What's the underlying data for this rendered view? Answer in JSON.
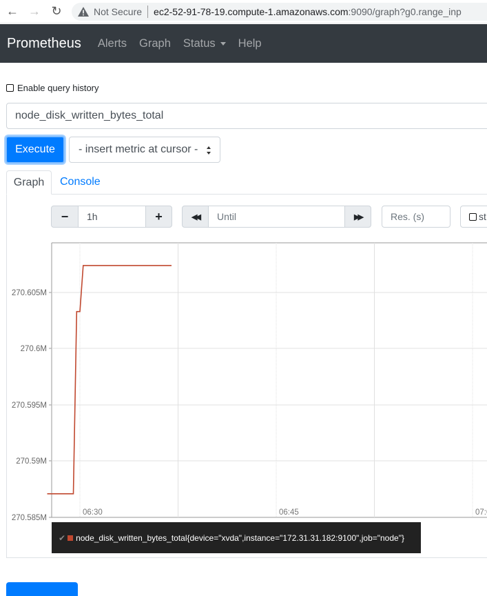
{
  "browser": {
    "not_secure": "Not Secure",
    "url_host": "ec2-52-91-78-19.compute-1.amazonaws.com",
    "url_rest": ":9090/graph?g0.range_inp"
  },
  "navbar": {
    "brand": "Prometheus",
    "links": [
      "Alerts",
      "Graph",
      "Status",
      "Help"
    ]
  },
  "query": {
    "history_label": "Enable query history",
    "expression": "node_disk_written_bytes_total",
    "execute_label": "Execute",
    "metric_select": "- insert metric at cursor -"
  },
  "tabs": {
    "graph": "Graph",
    "console": "Console"
  },
  "controls": {
    "minus": "−",
    "range": "1h",
    "plus": "+",
    "back": "◀◀",
    "until_placeholder": "Until",
    "forward": "▶▶",
    "res_placeholder": "Res. (s)",
    "stacked_label": "st"
  },
  "colors": {
    "series": "#c0482f",
    "primary": "#007bff",
    "navbar": "#343a40"
  },
  "chart_data": {
    "type": "line",
    "ylabel": "",
    "y_ticks": [
      "270.605M",
      "270.6M",
      "270.595M",
      "270.59M",
      "270.585M"
    ],
    "x_ticks": [
      "06:30",
      "06:45",
      "07:0"
    ],
    "series": [
      {
        "name": "node_disk_written_bytes_total{device=\"xvda\",instance=\"172.31.31.182:9100\",job=\"node\"}",
        "x": [
          "06:27:30",
          "06:29:30",
          "06:29:45",
          "06:30:00",
          "06:30:15",
          "06:30:30",
          "06:37:00"
        ],
        "y": [
          270.5871,
          270.5871,
          270.6033,
          270.6033,
          270.6074,
          270.6074,
          270.6074
        ]
      }
    ]
  },
  "legend": {
    "text": "node_disk_written_bytes_total{device=\"xvda\",instance=\"172.31.31.182:9100\",job=\"node\"}"
  }
}
